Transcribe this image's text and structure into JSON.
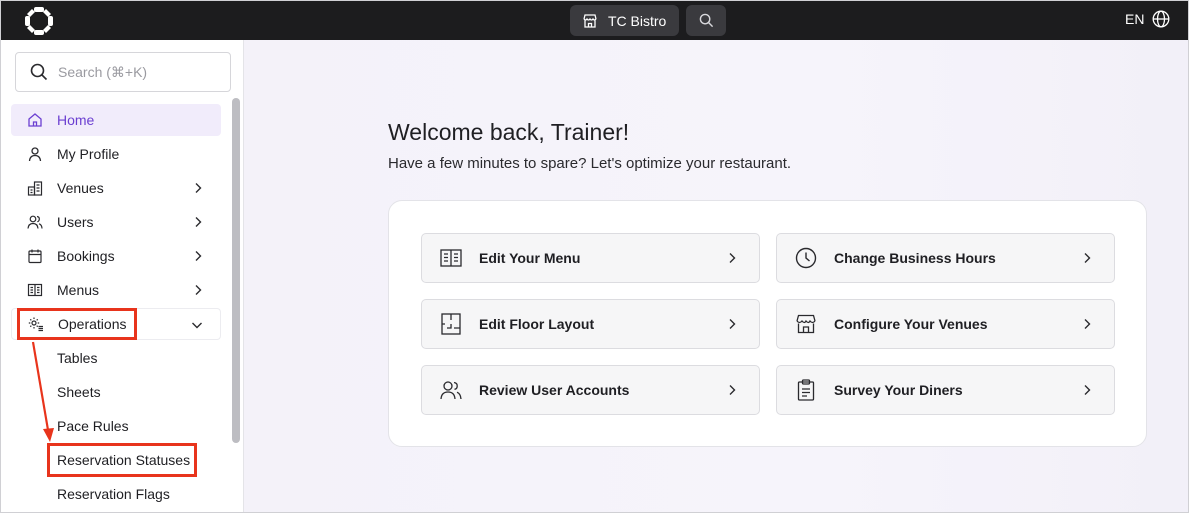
{
  "topbar": {
    "venue_name": "TC Bistro",
    "language": "EN"
  },
  "sidebar": {
    "search_placeholder": "Search (⌘+K)",
    "items": [
      {
        "label": "Home",
        "icon": "home-icon"
      },
      {
        "label": "My Profile",
        "icon": "user-icon"
      },
      {
        "label": "Venues",
        "icon": "building-icon"
      },
      {
        "label": "Users",
        "icon": "users-icon"
      },
      {
        "label": "Bookings",
        "icon": "calendar-icon"
      },
      {
        "label": "Menus",
        "icon": "menu-book-icon"
      },
      {
        "label": "Operations",
        "icon": "gear-list-icon"
      }
    ],
    "operations_sub": [
      "Tables",
      "Sheets",
      "Pace Rules",
      "Reservation Statuses",
      "Reservation Flags"
    ]
  },
  "main": {
    "welcome": "Welcome back, Trainer!",
    "subtitle": "Have a few minutes to spare? Let's optimize your restaurant.",
    "actions": [
      {
        "label": "Edit Your Menu",
        "icon": "menu-book-icon"
      },
      {
        "label": "Change Business Hours",
        "icon": "clock-icon"
      },
      {
        "label": "Edit Floor Layout",
        "icon": "floor-plan-icon"
      },
      {
        "label": "Configure Your Venues",
        "icon": "storefront-icon"
      },
      {
        "label": "Review User Accounts",
        "icon": "users-icon"
      },
      {
        "label": "Survey Your Diners",
        "icon": "clipboard-icon"
      }
    ]
  },
  "colors": {
    "topbar": "#1c1c1e",
    "accent": "#6b3fd1",
    "annotation": "#e8341c"
  }
}
